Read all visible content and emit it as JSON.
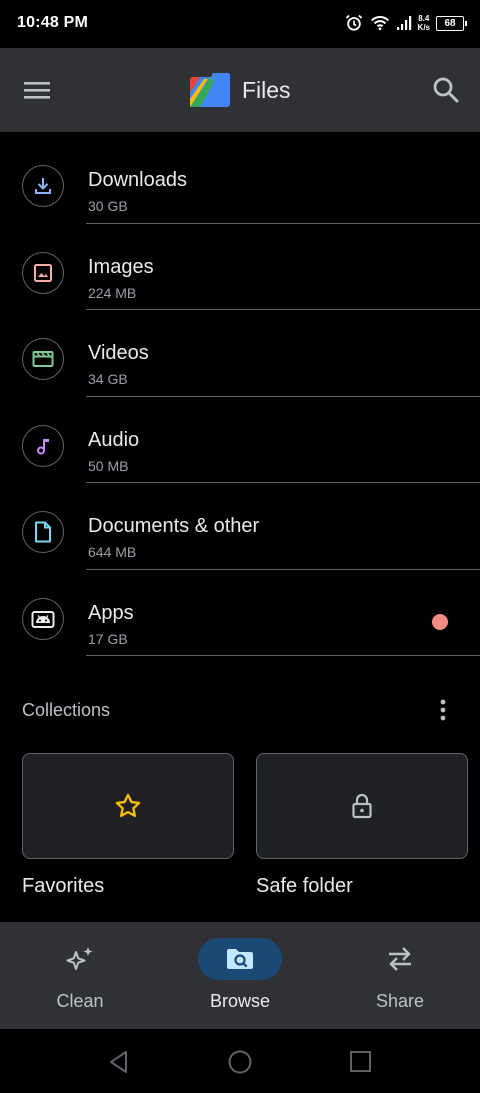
{
  "status_bar": {
    "time": "10:48 PM",
    "speed_value": "8.4",
    "speed_unit": "K/s",
    "battery": "68"
  },
  "app_bar": {
    "title": "Files"
  },
  "categories": [
    {
      "name": "Downloads",
      "size": "30 GB",
      "icon": "download-icon"
    },
    {
      "name": "Images",
      "size": "224 MB",
      "icon": "image-icon"
    },
    {
      "name": "Videos",
      "size": "34 GB",
      "icon": "video-icon"
    },
    {
      "name": "Audio",
      "size": "50 MB",
      "icon": "music-note-icon"
    },
    {
      "name": "Documents & other",
      "size": "644 MB",
      "icon": "document-icon"
    },
    {
      "name": "Apps",
      "size": "17 GB",
      "icon": "android-icon"
    }
  ],
  "collections": {
    "header": "Collections",
    "items": [
      {
        "label": "Favorites",
        "icon": "star-icon"
      },
      {
        "label": "Safe folder",
        "icon": "lock-icon"
      }
    ]
  },
  "bottom_nav": {
    "items": [
      {
        "label": "Clean",
        "icon": "sparkle-icon"
      },
      {
        "label": "Browse",
        "icon": "browse-icon",
        "active": true
      },
      {
        "label": "Share",
        "icon": "swap-icon"
      }
    ]
  },
  "colors": {
    "background": "#000000",
    "surface": "#303134",
    "downloads_icon": "#8ab4f8",
    "images_icon": "#f6aea9",
    "videos_icon": "#81c995",
    "audio_icon": "#c58af9",
    "documents_icon": "#78d9ec",
    "star": "#fbbc04",
    "notification_dot": "#f28b82",
    "active_nav": "#1a4a75"
  }
}
